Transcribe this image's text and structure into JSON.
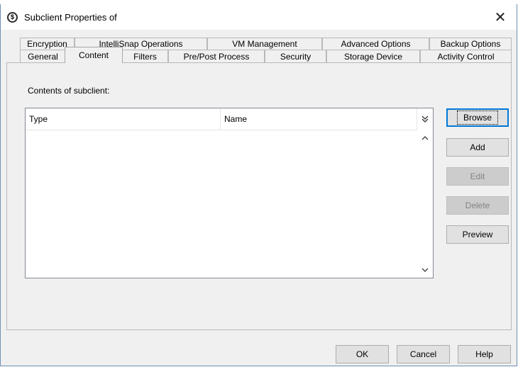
{
  "window": {
    "title": "Subclient Properties of",
    "close_label": "✕"
  },
  "tabs": {
    "row1": [
      "Encryption",
      "IntelliSnap Operations",
      "VM Management",
      "Advanced Options",
      "Backup Options"
    ],
    "row2": [
      "General",
      "Content",
      "Filters",
      "Pre/Post Process",
      "Security",
      "Storage Device",
      "Activity Control"
    ],
    "active": "Content"
  },
  "content": {
    "label": "Contents of subclient:",
    "columns": [
      "Type",
      "Name"
    ],
    "rows": []
  },
  "side_buttons": {
    "browse": "Browse",
    "add": "Add",
    "edit": "Edit",
    "delete": "Delete",
    "preview": "Preview"
  },
  "footer": {
    "ok": "OK",
    "cancel": "Cancel",
    "help": "Help"
  },
  "icons": {
    "app": "app-icon",
    "column_chooser": "column-chooser-icon",
    "scroll_up": "chevron-up-icon",
    "scroll_down": "chevron-down-icon"
  },
  "colors": {
    "window_border": "#6f8fb3",
    "default_button_border": "#0078d7"
  }
}
